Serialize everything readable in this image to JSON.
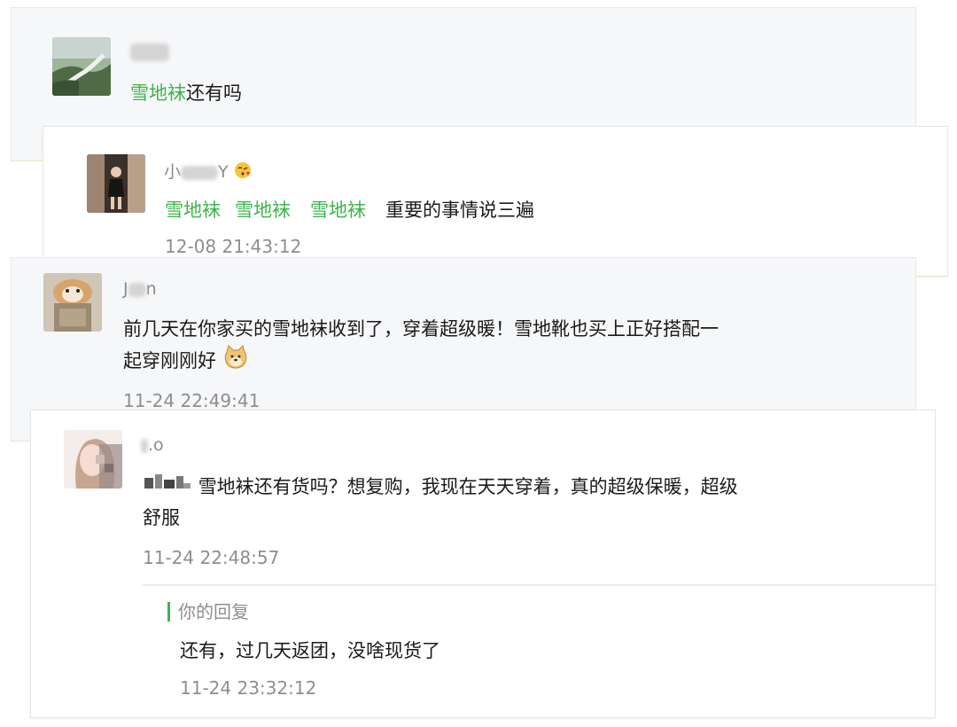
{
  "comments": [
    {
      "id": "c1",
      "name_visible": "",
      "message_parts": [
        {
          "text": "雪地袜",
          "style": "green"
        },
        {
          "text": "还有吗",
          "style": "normal"
        }
      ]
    },
    {
      "id": "c2",
      "name_prefix": "小",
      "name_suffix": "Y",
      "name_emoji": "kiss-face-emoji",
      "message_parts": [
        {
          "text": "雪地袜",
          "style": "green"
        },
        {
          "text": "雪地袜",
          "style": "green"
        },
        {
          "text": "雪地袜",
          "style": "green"
        },
        {
          "text": "重要的事情说三遍",
          "style": "normal"
        }
      ],
      "time": "12-08 21:43:12"
    },
    {
      "id": "c3",
      "name_prefix": "J",
      "name_suffix": "n",
      "message_line1": "前几天在你家买的雪地袜收到了，穿着超级暖！雪地靴也买上正好搭配一",
      "message_line2": "起穿刚刚好",
      "message_emoji": "doge-emoji",
      "time": "11-24 22:49:41"
    },
    {
      "id": "c4",
      "name_suffix": ".o",
      "message_prefix_icon": "blurred-emoji",
      "message_line1": "雪地袜还有货吗？想复购，我现在天天穿着，真的超级保暖，超级",
      "message_line2": "舒服",
      "time": "11-24 22:48:57",
      "reply": {
        "label": "你的回复",
        "text": "还有，过几天返团，没啥现货了",
        "time": "11-24 23:32:12"
      }
    }
  ],
  "colors": {
    "accent_green": "#3bb54a",
    "meta_gray": "#8e8e8e",
    "card_gray": "#f6f7f9"
  }
}
